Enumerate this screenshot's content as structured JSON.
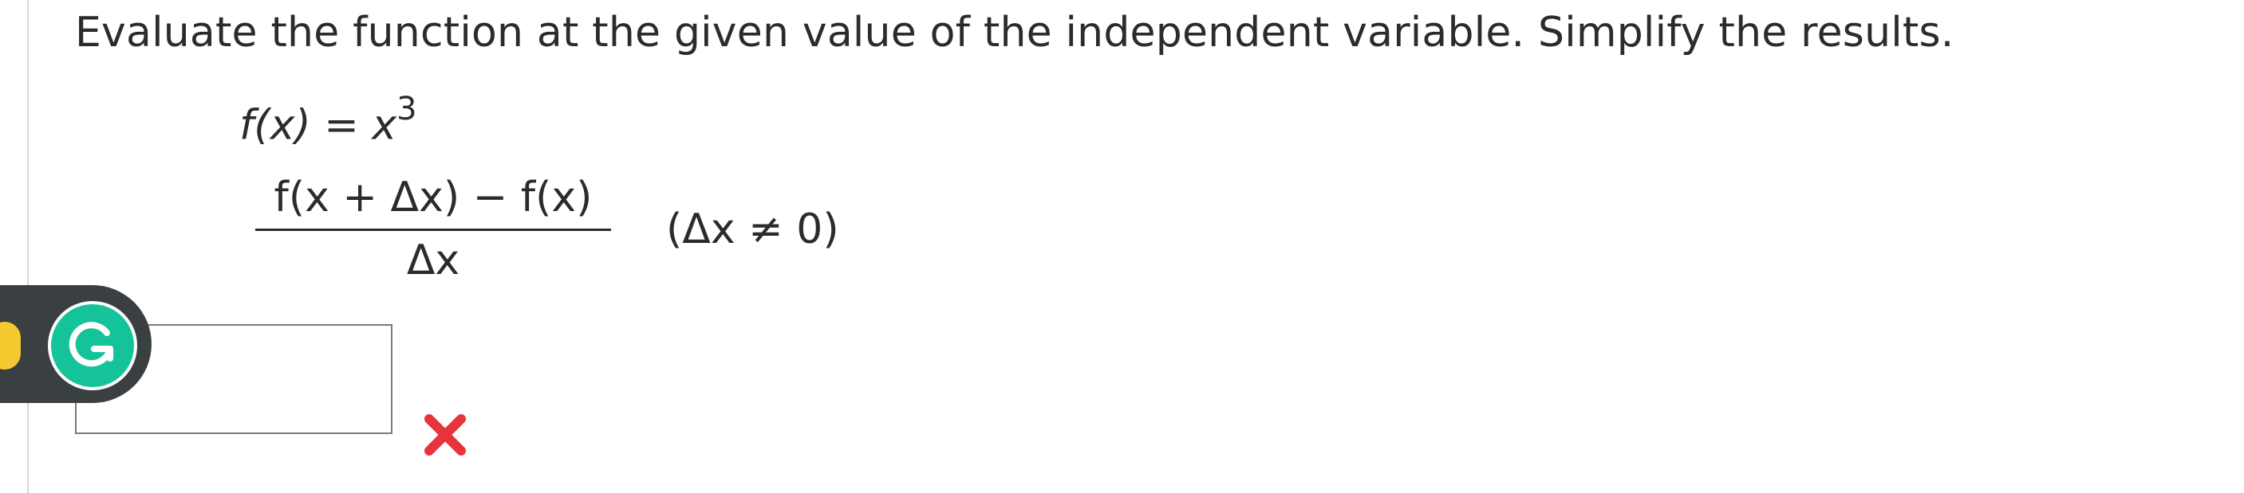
{
  "question": {
    "prompt": "Evaluate the function at the given value of the independent variable. Simplify the results.",
    "function_name": "f(x)",
    "equals": "=",
    "function_base": "x",
    "function_exponent": "3",
    "numerator": "f(x + Δx) − f(x)",
    "denominator": "Δx",
    "condition": "(Δx ≠ 0)"
  },
  "answer": {
    "value": "",
    "status": "incorrect",
    "status_color": "#e8333c"
  },
  "grammarly": {
    "brand_color": "#15c39a",
    "bulb_color": "#f4ca2f",
    "icon": "grammarly-g-icon"
  }
}
